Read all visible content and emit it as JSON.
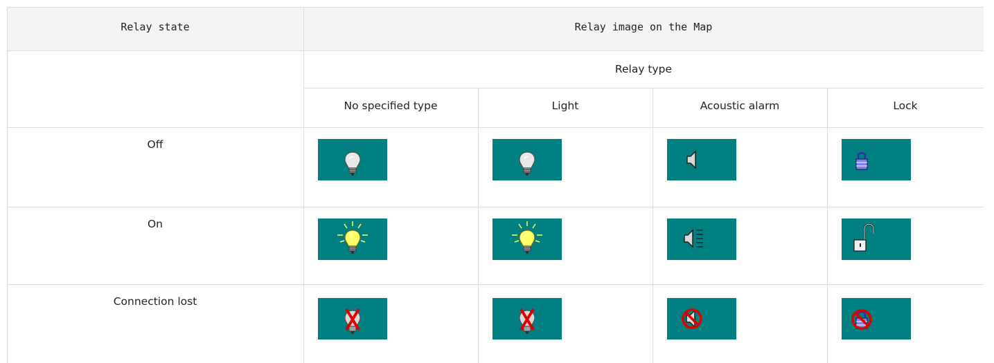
{
  "table": {
    "header": {
      "col1": "Relay state",
      "col2": "Relay image on the Map"
    },
    "relay_type_label": "Relay type",
    "types": [
      "No specified type",
      "Light",
      "Acoustic alarm",
      "Lock"
    ],
    "states": [
      "Off",
      "On",
      "Connection lost"
    ]
  },
  "icons": {
    "off": [
      "bulb-off-icon",
      "bulb-off-icon",
      "speaker-icon",
      "padlock-closed-icon"
    ],
    "on": [
      "bulb-on-icon",
      "bulb-on-icon",
      "speaker-sound-icon",
      "padlock-open-icon"
    ],
    "lost": [
      "bulb-crossed-icon",
      "bulb-crossed-icon",
      "speaker-prohibited-icon",
      "padlock-prohibited-icon"
    ]
  },
  "colors": {
    "icon_background": "#008080",
    "header_background": "#f4f4f4",
    "prohibited_red": "#e00000",
    "lock_blue": "#7070e0",
    "bulb_glow": "#ffff66"
  }
}
